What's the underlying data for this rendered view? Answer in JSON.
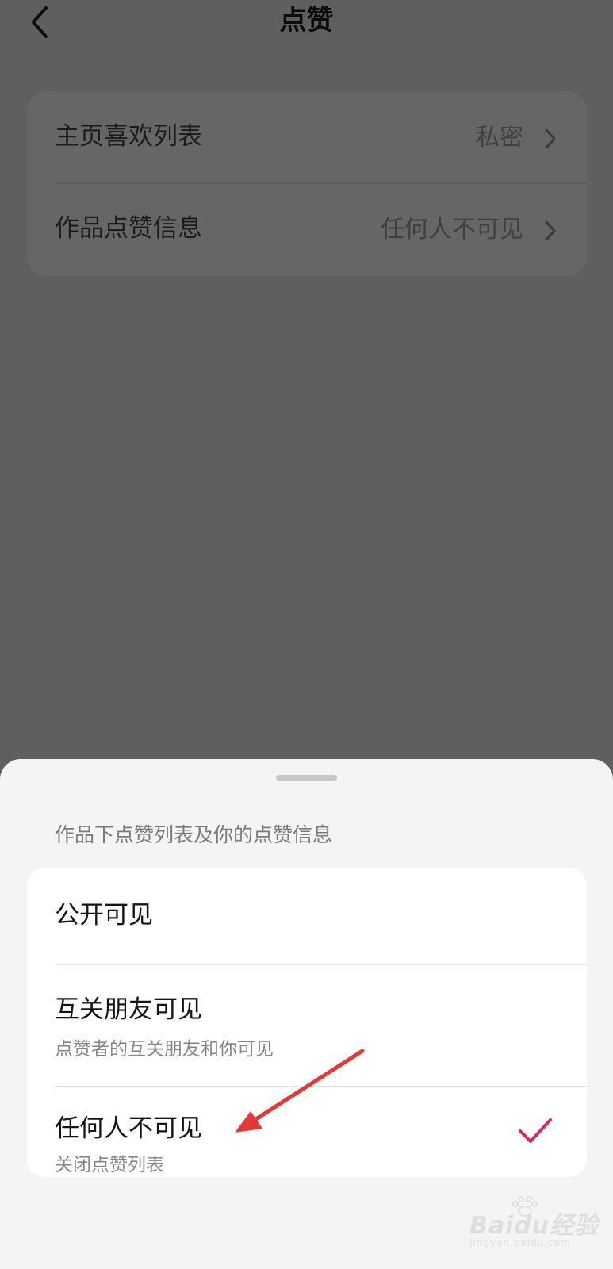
{
  "header": {
    "title": "点赞",
    "back_icon": "chevron-left-icon"
  },
  "settings": [
    {
      "label": "主页喜欢列表",
      "value": "私密"
    },
    {
      "label": "作品点赞信息",
      "value": "任何人不可见"
    }
  ],
  "sheet": {
    "caption": "作品下点赞列表及你的点赞信息",
    "options": [
      {
        "title": "公开可见",
        "desc": ""
      },
      {
        "title": "互关朋友可见",
        "desc": "点赞者的互关朋友和你可见"
      },
      {
        "title": "任何人不可见",
        "desc": "关闭点赞列表",
        "selected": true
      }
    ]
  },
  "watermark": {
    "logo": "Baidu经验",
    "url": "jingyan.baidu.com"
  },
  "colors": {
    "overlay": "#5f5f5f",
    "sheet_bg": "#f4f4f5",
    "check": "#e0245e",
    "arrow": "#e53935"
  }
}
